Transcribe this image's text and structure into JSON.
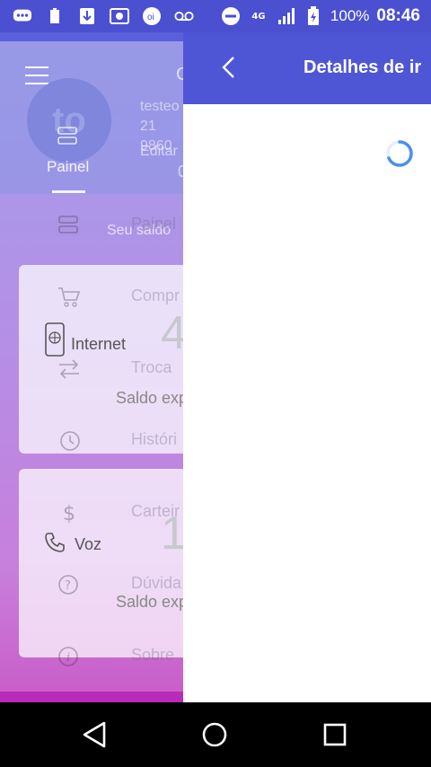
{
  "status_bar": {
    "battery_percent": "100%",
    "time": "08:46",
    "network": "4G",
    "icons": [
      "chat-bubble-icon",
      "battery-small-icon",
      "download-icon",
      "photo-icon",
      "oi-icon",
      "voicemail-icon"
    ]
  },
  "background_app": {
    "avatar_initials": "to",
    "header_letter": "C",
    "user_line1": "testeo",
    "user_line2": "21 9860",
    "edit_label": "Editar",
    "digit": "0",
    "tab_label": "Painel",
    "saldo_title": "Seu saldo",
    "cards": [
      {
        "label": "Internet",
        "value": "4",
        "sub": "Saldo exp"
      },
      {
        "label": "Voz",
        "value": "1",
        "sub": "Saldo exp"
      }
    ],
    "faded_menu": [
      {
        "label": "Painel",
        "icon": "dashboard-icon"
      },
      {
        "label": "Compr",
        "icon": "cart-icon"
      },
      {
        "label": "Troca",
        "icon": "swap-icon"
      },
      {
        "label": "Históri",
        "icon": "history-icon"
      },
      {
        "label": "Carteir",
        "icon": "dollar-icon"
      },
      {
        "label": "Dúvida",
        "icon": "help-icon"
      },
      {
        "label": "Sobre",
        "icon": "info-icon"
      }
    ]
  },
  "detail_panel": {
    "title": "Detalhes de ir",
    "loading": true
  },
  "colors": {
    "accent": "#4f56d6",
    "spinner": "#4b8ff0"
  }
}
